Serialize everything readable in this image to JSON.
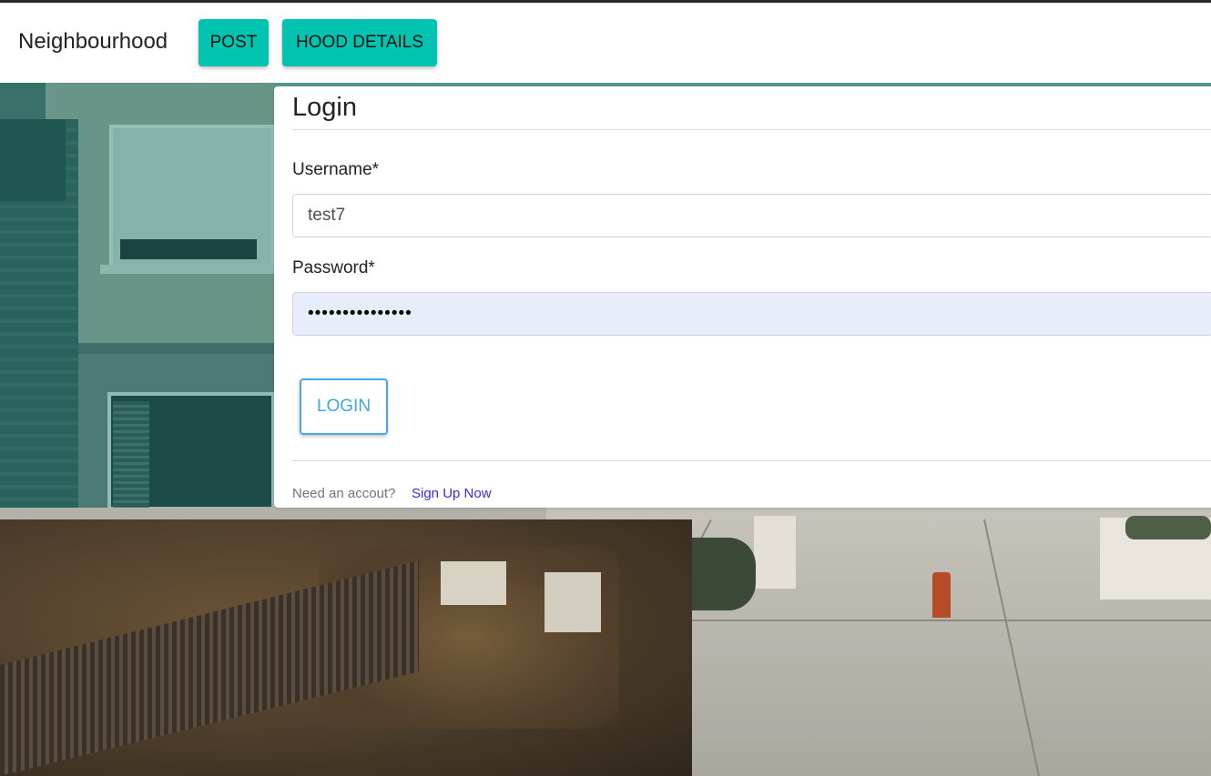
{
  "navbar": {
    "brand": "Neighbourhood",
    "post_label": "POST",
    "hood_details_label": "HOOD DETAILS",
    "button_color": "#00c4b0"
  },
  "login": {
    "title": "Login",
    "username_label": "Username*",
    "username_value": "test7",
    "password_label": "Password*",
    "password_value": "•••••••••••••••",
    "login_button": "LOGIN",
    "footer_text": "Need an accout?",
    "signup_link": "Sign Up Now"
  }
}
